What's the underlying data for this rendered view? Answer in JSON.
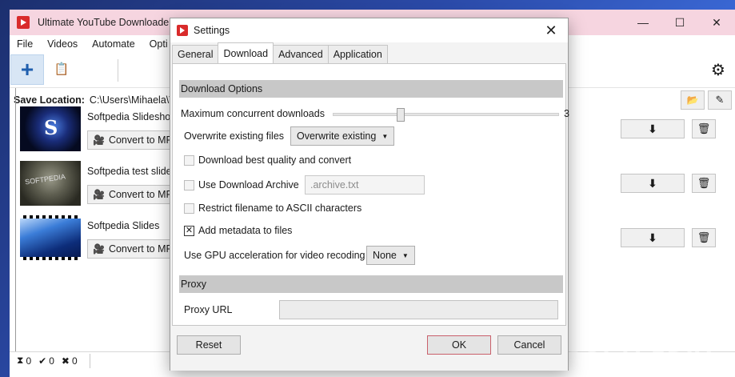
{
  "app": {
    "title": "Ultimate YouTube Downloader",
    "window_controls": {
      "minimize": "—",
      "maximize": "☐",
      "close": "✕"
    },
    "menu": [
      "File",
      "Videos",
      "Automate",
      "Opti"
    ],
    "toolbar": {
      "add_icon": "+",
      "paste_icon": "📋",
      "gear_icon": "⚙"
    },
    "save_location_label": "Save Location:",
    "save_location_path": "C:\\Users\\Mihaela\\Vid",
    "folder_icon": "📂",
    "edit_icon": "✎",
    "items": [
      {
        "title": "Softpedia Slideshow",
        "convert_label": "Convert to MP3"
      },
      {
        "title": "Softpedia test slides",
        "convert_label": "Convert to MP3"
      },
      {
        "title": "Softpedia Slides",
        "convert_label": "Convert to MP3"
      }
    ],
    "camera_icon": "🎥",
    "download_icon": "⬇",
    "delete_icon": "🗑",
    "status": {
      "pending_icon": "⧗",
      "pending": "0",
      "done_icon": "✔",
      "done": "0",
      "failed_icon": "✖",
      "failed": "0"
    },
    "watermark": "SOFTPEDIA"
  },
  "dialog": {
    "title": "Settings",
    "close_icon": "✕",
    "tabs": [
      "General",
      "Download",
      "Advanced",
      "Application"
    ],
    "active_tab": "Download",
    "download_options_header": "Download Options",
    "max_concurrent_label": "Maximum concurrent downloads",
    "max_concurrent_value": "3",
    "max_concurrent_fraction": 0.29,
    "overwrite_label": "Overwrite existing files",
    "overwrite_value": "Overwrite existing",
    "best_quality_label": "Download best quality and convert",
    "best_quality_checked": false,
    "archive_label": "Use Download Archive",
    "archive_checked": false,
    "archive_placeholder": ".archive.txt",
    "restrict_ascii_label": "Restrict filename to ASCII characters",
    "restrict_ascii_checked": false,
    "metadata_label": "Add metadata to files",
    "metadata_checked": true,
    "check_mark": "✕",
    "gpu_label": "Use GPU acceleration for video recoding",
    "gpu_value": "None",
    "proxy_header": "Proxy",
    "proxy_url_label": "Proxy URL",
    "proxy_url_value": "",
    "caret": "▼",
    "reset_label": "Reset",
    "ok_label": "OK",
    "cancel_label": "Cancel"
  }
}
